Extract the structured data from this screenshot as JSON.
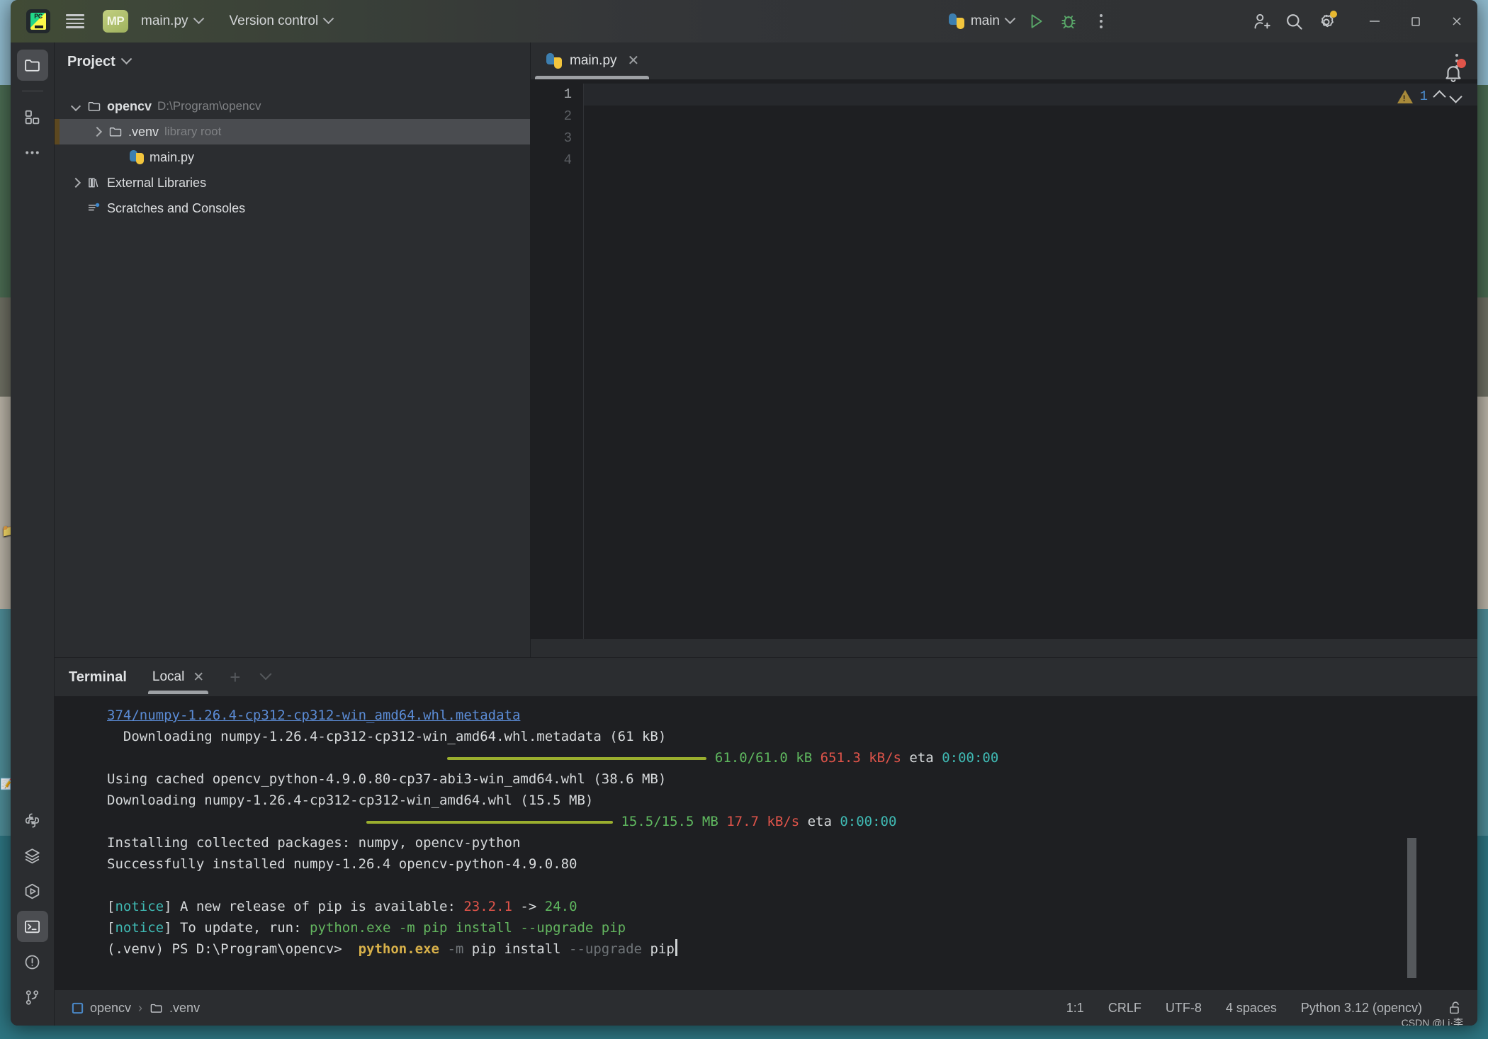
{
  "window": {
    "app_logo": "pycharm-logo-icon",
    "menu_icon": "hamburger-menu-icon",
    "project_badge": "MP",
    "file_dropdown": "main.py",
    "vcs_dropdown": "Version control",
    "run_config": "main",
    "minimize": "—",
    "maximize": "☐",
    "close": "✕"
  },
  "toolbar_icons": {
    "run": "run-play-icon",
    "debug": "debug-bug-icon",
    "more": "more-vertical-icon",
    "account": "add-user-icon",
    "search": "search-icon",
    "settings": "settings-gear-icon",
    "notifications": "notifications-bell-icon"
  },
  "rail": {
    "top": [
      {
        "name": "project-tool-icon",
        "label": "Project",
        "active": true
      },
      {
        "name": "bookmarks-tool-icon",
        "label": "Bookmarks",
        "active": false
      },
      {
        "name": "more-tool-windows-icon",
        "label": "More tool windows",
        "active": false
      }
    ],
    "bottom": [
      {
        "name": "python-console-icon",
        "label": "Python Console",
        "active": false
      },
      {
        "name": "services-layers-icon",
        "label": "Services",
        "active": false
      },
      {
        "name": "run-hexagon-icon",
        "label": "Run",
        "active": false
      },
      {
        "name": "terminal-icon",
        "label": "Terminal",
        "active": true
      },
      {
        "name": "problems-icon",
        "label": "Problems",
        "active": false
      },
      {
        "name": "git-branch-icon",
        "label": "Version Control",
        "active": false
      }
    ]
  },
  "project_panel": {
    "title": "Project",
    "tree": [
      {
        "label": "opencv",
        "sub": "D:\\Program\\opencv",
        "icon": "folder-icon",
        "arrow": "open",
        "indent": 1,
        "bold": true,
        "selected": false
      },
      {
        "label": ".venv",
        "sub": "library root",
        "icon": "folder-icon",
        "arrow": "closed",
        "indent": 2,
        "bold": false,
        "selected": true
      },
      {
        "label": "main.py",
        "sub": "",
        "icon": "python-file-icon",
        "arrow": "none",
        "indent": 3,
        "bold": false,
        "selected": false
      },
      {
        "label": "External Libraries",
        "sub": "",
        "icon": "library-icon",
        "arrow": "closed",
        "indent": 1,
        "bold": false,
        "selected": false
      },
      {
        "label": "Scratches and Consoles",
        "sub": "",
        "icon": "scratches-icon",
        "arrow": "none",
        "indent": 1,
        "bold": false,
        "selected": false
      }
    ]
  },
  "editor": {
    "tab": {
      "label": "main.py",
      "icon": "python-file-icon",
      "close": "✕"
    },
    "more_icon": "editor-more-icon",
    "line_numbers": [
      "1",
      "2",
      "3",
      "4"
    ],
    "inspection": {
      "warning_count": "1",
      "prev_icon": "chevron-up-icon",
      "next_icon": "chevron-down-icon"
    }
  },
  "terminal": {
    "title": "Terminal",
    "tab": "Local",
    "tab_close": "✕",
    "new_tab": "+",
    "dropdown": "chevron-down-icon",
    "lines": [
      {
        "id": "l1",
        "segs": [
          {
            "t": "374/numpy-1.26.4-cp312-cp312-win_amd64.whl.metadata",
            "c": "c-link"
          }
        ]
      },
      {
        "id": "l2",
        "segs": [
          {
            "t": "  Downloading numpy-1.26.4-cp312-cp312-win_amd64.whl.metadata (61 kB)",
            "c": "c-white"
          }
        ]
      },
      {
        "id": "l3",
        "bar": 366,
        "bar_indent": 42,
        "segs": [
          {
            "t": " 61.0/61.0 kB ",
            "c": "c-green"
          },
          {
            "t": "651.3 kB/s",
            "c": "c-red"
          },
          {
            "t": " eta ",
            "c": "c-white"
          },
          {
            "t": "0:00:00",
            "c": "c-cyan"
          }
        ]
      },
      {
        "id": "l4",
        "segs": [
          {
            "t": "Using cached opencv_python-4.9.0.80-cp37-abi3-win_amd64.whl (38.6 MB)",
            "c": "c-white"
          }
        ]
      },
      {
        "id": "l5",
        "segs": [
          {
            "t": "Downloading numpy-1.26.4-cp312-cp312-win_amd64.whl (15.5 MB)",
            "c": "c-white"
          }
        ]
      },
      {
        "id": "l6",
        "bar": 348,
        "bar_indent": 32,
        "segs": [
          {
            "t": " 15.5/15.5 MB ",
            "c": "c-green"
          },
          {
            "t": "17.7 kB/s",
            "c": "c-red"
          },
          {
            "t": " eta ",
            "c": "c-white"
          },
          {
            "t": "0:00:00",
            "c": "c-cyan"
          }
        ]
      },
      {
        "id": "l7",
        "segs": [
          {
            "t": "Installing collected packages: numpy, opencv-python",
            "c": "c-white"
          }
        ]
      },
      {
        "id": "l8",
        "segs": [
          {
            "t": "Successfully installed numpy-1.26.4 opencv-python-4.9.0.80",
            "c": "c-white"
          }
        ]
      },
      {
        "id": "l9",
        "segs": [
          {
            "t": "",
            "c": "c-white"
          }
        ]
      },
      {
        "id": "l10",
        "segs": [
          {
            "t": "[",
            "c": "c-white"
          },
          {
            "t": "notice",
            "c": "c-cyan"
          },
          {
            "t": "] A new release of pip is available: ",
            "c": "c-white"
          },
          {
            "t": "23.2.1",
            "c": "c-red"
          },
          {
            "t": " -> ",
            "c": "c-white"
          },
          {
            "t": "24.0",
            "c": "c-green"
          }
        ]
      },
      {
        "id": "l11",
        "segs": [
          {
            "t": "[",
            "c": "c-white"
          },
          {
            "t": "notice",
            "c": "c-cyan"
          },
          {
            "t": "] To update, run: ",
            "c": "c-white"
          },
          {
            "t": "python.exe -m pip install --upgrade pip",
            "c": "c-cmdgreen"
          }
        ]
      },
      {
        "id": "l12",
        "prompt": true,
        "segs": [
          {
            "t": "(.venv) PS D:\\Program\\opencv>  ",
            "c": "c-white"
          },
          {
            "t": "python.exe",
            "c": "c-yellow"
          },
          {
            "t": " -m",
            "c": "c-dim"
          },
          {
            "t": " pip install",
            "c": "c-white"
          },
          {
            "t": " --upgrade",
            "c": "c-dim"
          },
          {
            "t": " pip",
            "c": "c-white"
          }
        ]
      }
    ]
  },
  "statusbar": {
    "breadcrumb": [
      {
        "label": "opencv",
        "icon": "project-square-icon"
      },
      {
        "label": ".venv",
        "icon": "folder-icon"
      }
    ],
    "separator": "›",
    "right": [
      "1:1",
      "CRLF",
      "UTF-8",
      "4 spaces",
      "Python 3.12 (opencv)"
    ],
    "lock_icon": "unlocked-padlock-icon",
    "watermark": "CSDN @Li·李"
  },
  "colors": {
    "window_bg": "#2b2d30",
    "editor_bg": "#1e1f22",
    "selection": "#4a4c50",
    "accent_gold": "#5c4820",
    "link_blue": "#5b8cd6",
    "warn_gold": "#a88a3a",
    "progress_green": "#9aae2e"
  }
}
